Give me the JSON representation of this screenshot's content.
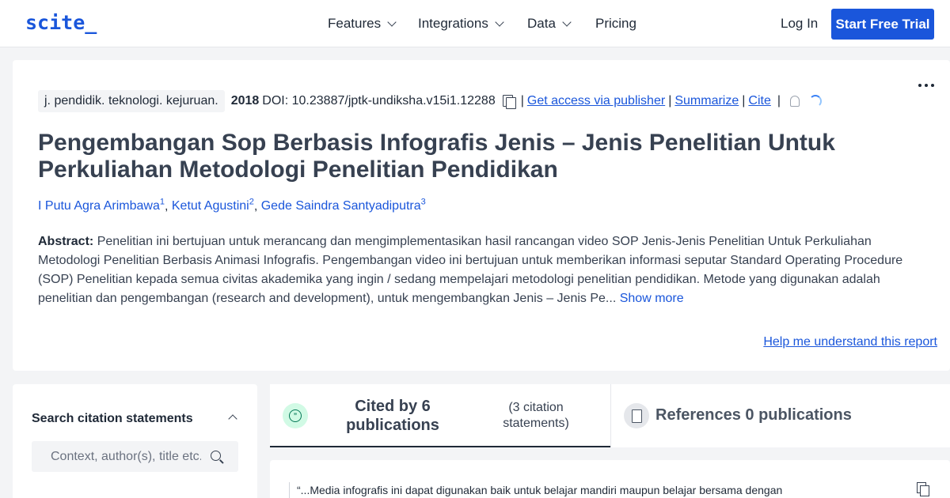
{
  "nav": {
    "logo": "scite_",
    "items": [
      {
        "label": "Features"
      },
      {
        "label": "Integrations"
      },
      {
        "label": "Data"
      },
      {
        "label": "Pricing"
      }
    ],
    "login": "Log In",
    "cta": "Start Free Trial"
  },
  "paper": {
    "journal": "j. pendidik. teknologi. kejuruan.",
    "year": "2018",
    "doi": "DOI: 10.23887/jptk-undiksha.v15i1.12288",
    "sep": "|",
    "get_access": "Get access via publisher",
    "summarize": "Summarize",
    "cite": "Cite",
    "title": "Pengembangan Sop Berbasis Infografis Jenis – Jenis Penelitian Untuk Perkuliahan Metodologi Penelitian Pendidikan",
    "authors": [
      {
        "name": "I Putu Agra Arimbawa",
        "sup": "1"
      },
      {
        "name": "Ketut Agustini",
        "sup": "2"
      },
      {
        "name": "Gede Saindra Santyadiputra",
        "sup": "3"
      }
    ],
    "abstract_label": "Abstract:",
    "abstract": "Penelitian ini bertujuan untuk merancang dan mengimplementasikan hasil rancangan video SOP Jenis-Jenis Penelitian Untuk Perkuliahan Metodologi Penelitian Berbasis Animasi Infografis. Pengembangan video ini bertujuan untuk memberikan informasi seputar Standard Operating Procedure (SOP) Penelitian kepada semua civitas akademika yang ingin / sedang mempelajari metodologi penelitian pendidikan. Metode yang digunakan adalah penelitian dan pengembangan (research and development), untuk mengembangkan Jenis – Jenis Pe...",
    "show_more": "Show more",
    "help_link": "Help me understand this report"
  },
  "search": {
    "title": "Search citation statements",
    "placeholder": "Context, author(s), title etc."
  },
  "tabs": {
    "cited_label": "Cited by 6 publications",
    "cited_sub": "(3 citation statements)",
    "refs_label": "References 0 publications"
  },
  "citation_preview": {
    "text": "“...Media infografis ini dapat digunakan baik untuk belajar mandiri maupun belajar bersama dengan"
  },
  "colors": {
    "accent": "#1a56db",
    "cited_icon_bg": "#d1fae5",
    "cited_icon_fg": "#047857"
  },
  "icons": [
    "chevron-down-icon",
    "copy-icon",
    "bell-icon",
    "spinner-icon",
    "more-icon",
    "chevron-up-icon",
    "search-icon",
    "quote-icon",
    "document-icon"
  ]
}
